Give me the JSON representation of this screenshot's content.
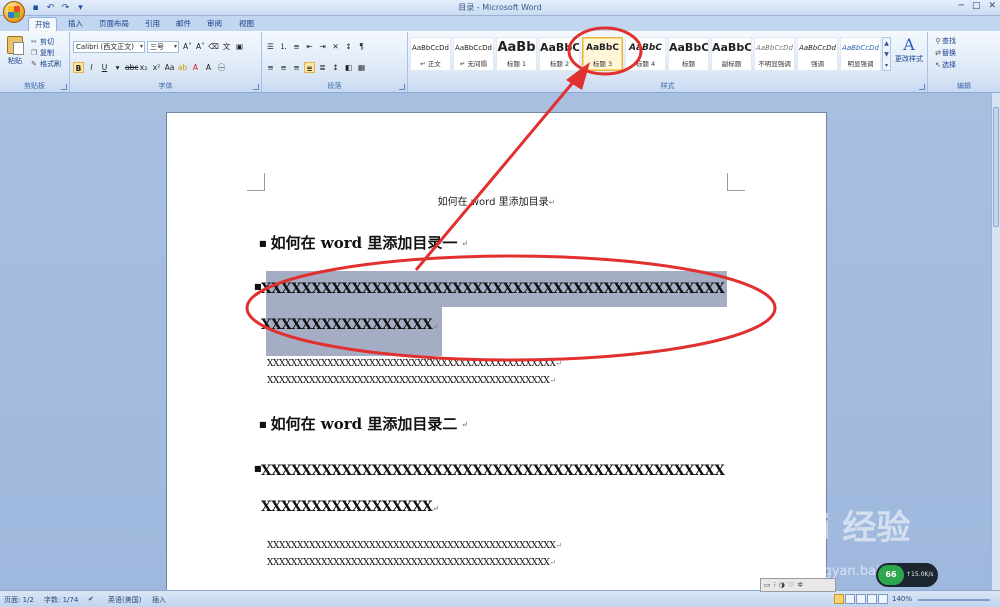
{
  "window": {
    "title": "目录 - Microsoft Word"
  },
  "tabs": [
    "开始",
    "插入",
    "页面布局",
    "引用",
    "邮件",
    "审阅",
    "视图"
  ],
  "clipboard": {
    "paste": "粘贴",
    "cut": "剪切",
    "copy": "复制",
    "format_painter": "格式刷",
    "group": "剪贴板"
  },
  "font": {
    "name": "Calibri (西文正文)",
    "size": "三号",
    "group": "字体"
  },
  "paragraph": {
    "group": "段落"
  },
  "styles": {
    "group": "样式",
    "items": [
      {
        "sample": "AaBbCcDd",
        "name": "↵ 正文"
      },
      {
        "sample": "AaBbCcDd",
        "name": "↵ 无间隔"
      },
      {
        "sample": "AaBb",
        "name": "标题 1"
      },
      {
        "sample": "AaBbC",
        "name": "标题 2"
      },
      {
        "sample": "AaBbC",
        "name": "标题 3"
      },
      {
        "sample": "AaBbC",
        "name": "标题 4"
      },
      {
        "sample": "AaBbC",
        "name": "标题"
      },
      {
        "sample": "AaBbC",
        "name": "副标题"
      },
      {
        "sample": "AaBbCcDd",
        "name": "不明显强调"
      },
      {
        "sample": "AaBbCcDd",
        "name": "强调"
      },
      {
        "sample": "AaBbCcDd",
        "name": "明显强调"
      }
    ],
    "selected_index": 4,
    "change_styles": "更改样式"
  },
  "editing": {
    "find": "查找",
    "replace": "替换",
    "select": "选择",
    "group": "编辑"
  },
  "document": {
    "header": "如何在 word 里添加目录",
    "heading1": "如何在 word 里添加目录一",
    "heading2a_line1": "XXXXXXXXXXXXXXXXXXXXXXXXXXXXXXXXXXXXXXXXXXXXXX",
    "heading2a_line2": "XXXXXXXXXXXXXXXXX",
    "body1_line1": "XXXXXXXXXXXXXXXXXXXXXXXXXXXXXXXXXXXXXXXXXXXXXXXX",
    "body1_line2": "XXXXXXXXXXXXXXXXXXXXXXXXXXXXXXXXXXXXXXXXXXXXXXX",
    "heading1b": "如何在 word 里添加目录二",
    "heading2b_line1": "XXXXXXXXXXXXXXXXXXXXXXXXXXXXXXXXXXXXXXXXXXXXXX",
    "heading2b_line2": "XXXXXXXXXXXXXXXXX",
    "body2_line1": "XXXXXXXXXXXXXXXXXXXXXXXXXXXXXXXXXXXXXXXXXXXXXXXX",
    "body2_line2": "XXXXXXXXXXXXXXXXXXXXXXXXXXXXXXXXXXXXXXXXXXXXXXX"
  },
  "status": {
    "page": "页面: 1/2",
    "words": "字数: 1/74",
    "language": "英语(美国)",
    "mode": "插入",
    "zoom": "140%"
  },
  "overlay": {
    "watermark": "Bai 经验",
    "watermark_url": "jingyan.baidu.com",
    "badge_value": "66",
    "badge_speed": "↑15.0K/s"
  },
  "colors": {
    "annotation": "#e03030",
    "selection": "#a5adc5",
    "selected_style": "#e9b44b"
  }
}
